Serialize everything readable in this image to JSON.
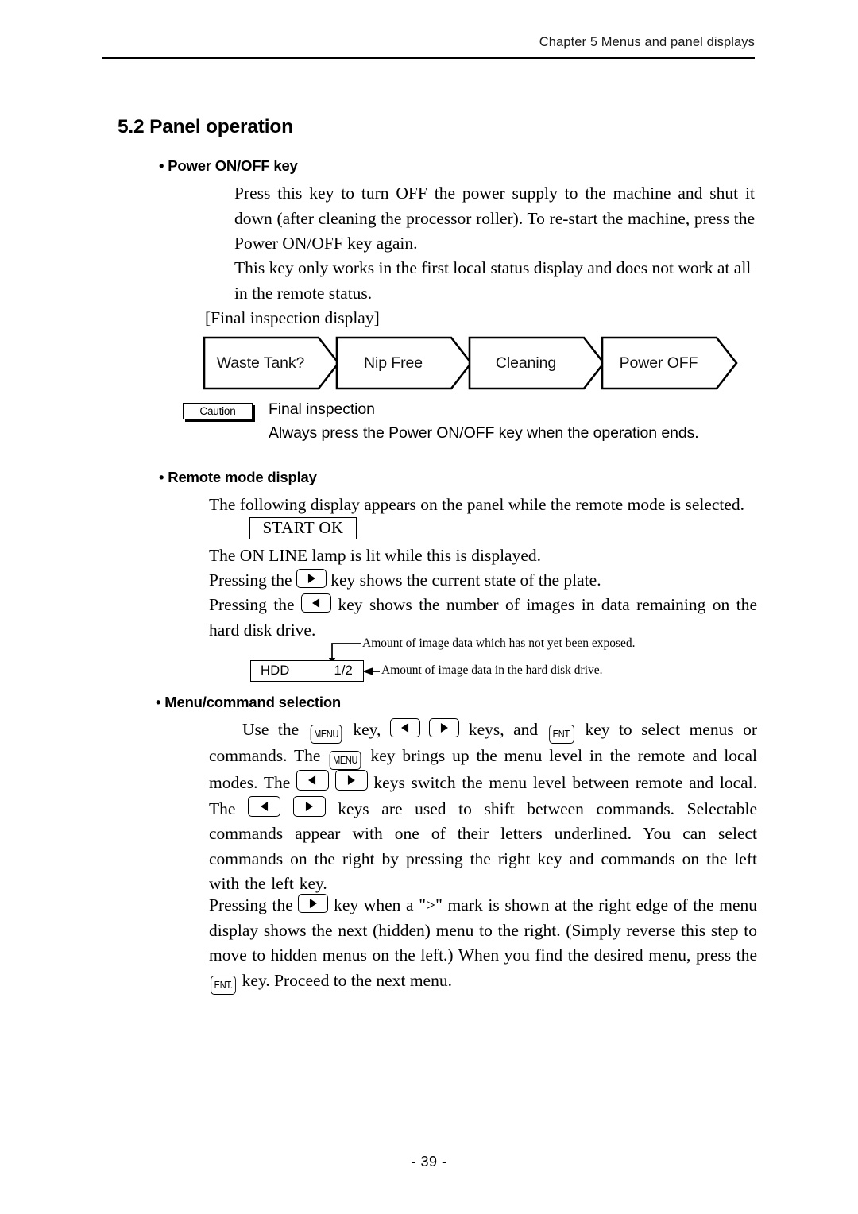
{
  "header": {
    "chapter": "Chapter 5  Menus and panel displays"
  },
  "section": {
    "title": "5.2 Panel operation"
  },
  "power_key": {
    "heading": "Power ON/OFF key",
    "para1": "Press this key to turn OFF the power supply to the machine and shut it down (after cleaning the processor roller).  To re-start the machine, press the Power ON/OFF key again.",
    "para2": "This key only works in the first local status display and does not work at all in the remote status.",
    "figure_caption": "[Final inspection display]"
  },
  "flowchart": {
    "steps": [
      {
        "label": "Waste Tank?"
      },
      {
        "label": "Nip Free"
      },
      {
        "label": "Cleaning"
      },
      {
        "label": "Power OFF"
      }
    ]
  },
  "caution": {
    "badge": "Caution",
    "title": "Final inspection",
    "text": "Always press the Power ON/OFF key when the operation ends."
  },
  "remote_mode": {
    "heading": "Remote mode display",
    "para1": "The following display appears on the panel while the remote mode is selected.",
    "display_value": "START  OK",
    "para2": "The ON LINE lamp is lit while this is displayed.",
    "para3_a": "Pressing the",
    "para3_b": "key shows the current state of the plate.",
    "para4_a": "Pressing the",
    "para4_b": "key shows the number of images in data remaining on the hard disk drive."
  },
  "hdd_figure": {
    "label": "HDD",
    "count": "1/2",
    "note_top": "Amount of image data which has not yet been exposed.",
    "note_bottom": "Amount of image data in the hard disk drive."
  },
  "menu_selection": {
    "heading": "Menu/command selection",
    "p1_a": "Use the",
    "p1_b": "key,",
    "p1_c": "keys, and",
    "p1_d": "key to select menus or commands.  The",
    "p1_e": "key brings up the menu level in the remote and local modes.  The",
    "p1_f": "keys switch the menu level between remote and local.  The",
    "p1_g": "keys are used to shift between commands.  Selectable commands appear with one of their letters underlined.  You can select commands on the right by pressing the right key and commands on the left with the left key.",
    "p2_a": "Pressing the",
    "p2_b": "key when a \">\" mark is shown at the right edge of the menu display shows the next (hidden) menu to the right.  (Simply reverse this step to move to hidden menus on the left.)  When you find the desired menu, press the",
    "p2_c": "key. Proceed to the next menu."
  },
  "keys": {
    "menu": "MENU",
    "ent": "ENT.",
    "right": "right-arrow",
    "left": "left-arrow"
  },
  "footer": {
    "page": "- 39 -"
  },
  "colors": {
    "ink": "#000000",
    "paper": "#ffffff"
  }
}
